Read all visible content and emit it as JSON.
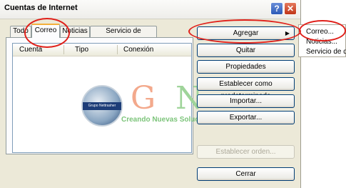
{
  "window": {
    "title": "Cuentas de Internet"
  },
  "tabs": [
    {
      "label": "Todo"
    },
    {
      "label": "Correo"
    },
    {
      "label": "Noticias"
    },
    {
      "label": "Servicio de directorio"
    }
  ],
  "list": {
    "columns": [
      "Cuenta",
      "Tipo",
      "Conexión"
    ]
  },
  "watermark": {
    "logo_text": "Grupo Nettrasher",
    "letter_g": "G",
    "letter_n": "N",
    "tagline": "Creando Nuevas Soluciones"
  },
  "buttons": {
    "agregar": "Agregar",
    "quitar": "Quitar",
    "propiedades": "Propiedades",
    "predeterminada": "Establecer como predeterminada",
    "importar": "Importar...",
    "exportar": "Exportar...",
    "orden": "Establecer orden...",
    "cerrar": "Cerrar"
  },
  "menu": {
    "items": [
      "Correo...",
      "Noticias...",
      "Servicio de di"
    ]
  },
  "colors": {
    "highlight": "#e0201a",
    "window_bg": "#ece9d8",
    "tab_accent": "#f3b03b"
  }
}
